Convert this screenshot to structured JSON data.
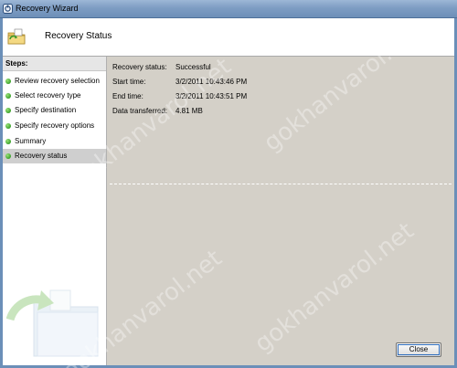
{
  "window": {
    "title": "Recovery Wizard"
  },
  "header": {
    "title": "Recovery Status"
  },
  "sidebar": {
    "heading": "Steps:",
    "steps": [
      {
        "label": "Review recovery selection",
        "active": false
      },
      {
        "label": "Select recovery type",
        "active": false
      },
      {
        "label": "Specify destination",
        "active": false
      },
      {
        "label": "Specify recovery options",
        "active": false
      },
      {
        "label": "Summary",
        "active": false
      },
      {
        "label": "Recovery status",
        "active": true
      }
    ]
  },
  "status": {
    "rows": [
      {
        "key": "Recovery status:",
        "value": "Successful"
      },
      {
        "key": "Start time:",
        "value": "3/2/2011 10:43:46 PM"
      },
      {
        "key": "End time:",
        "value": "3/2/2011 10:43:51 PM"
      },
      {
        "key": "Data transferred:",
        "value": "4.81 MB"
      }
    ]
  },
  "footer": {
    "close_label": "Close"
  },
  "watermark": "gokhanvarol.net",
  "icons": {
    "title": "wizard-app-icon",
    "header": "folder-recovery-icon",
    "step": "green-dot-icon"
  }
}
